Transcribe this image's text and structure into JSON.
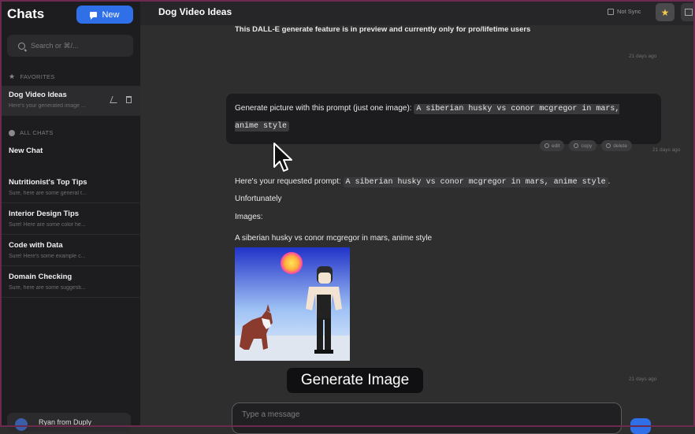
{
  "sidebar": {
    "title": "Chats",
    "new_label": "New",
    "search_placeholder": "Search or ⌘/...",
    "favorites_label": "FAVORITES",
    "all_chats_label": "ALL CHATS",
    "favorites": [
      {
        "title": "Dog Video Ideas",
        "preview": "Here's your generated image ..."
      }
    ],
    "chats": [
      {
        "title": "New Chat",
        "preview": ""
      },
      {
        "title": "Nutritionist's Top Tips",
        "preview": "Sure, here are some general t..."
      },
      {
        "title": "Interior Design Tips",
        "preview": "Sure! Here are some color he..."
      },
      {
        "title": "Code with Data",
        "preview": "Sure! Here's some example c..."
      },
      {
        "title": "Domain Checking",
        "preview": "Sure, here are some suggesti..."
      }
    ],
    "user_name": "Ryan from Duply"
  },
  "header": {
    "title": "Dog Video Ideas",
    "sync_label": "Not Sync",
    "star_icon": "star-icon"
  },
  "messages": {
    "notice": "This DALL-E generate feature is in preview and currently only for pro/lifetime users",
    "timestamp_1": "21 days ago",
    "user_prompt_prefix": "Generate picture with this prompt (just one image):",
    "user_prompt_code": "A siberian husky vs conor mcgregor in mars, anime style",
    "actions": [
      "edit",
      "copy",
      "delete"
    ],
    "timestamp_2": "21 days ago",
    "reply_prefix": "Here's your requested prompt:",
    "reply_code": "A siberian husky vs conor mcgregor in mars, anime style",
    "reply_suffix": ". Unfortunately",
    "images_label": "Images:",
    "image_caption": "A siberian husky vs conor mcgregor in mars, anime style",
    "overlay_label": "Generate Image",
    "timestamp_3": "21 days ago"
  },
  "composer": {
    "placeholder": "Type a message"
  },
  "colors": {
    "accent": "#2f6fe8",
    "active_marker": "#d9245f",
    "star": "#f2c94c"
  }
}
